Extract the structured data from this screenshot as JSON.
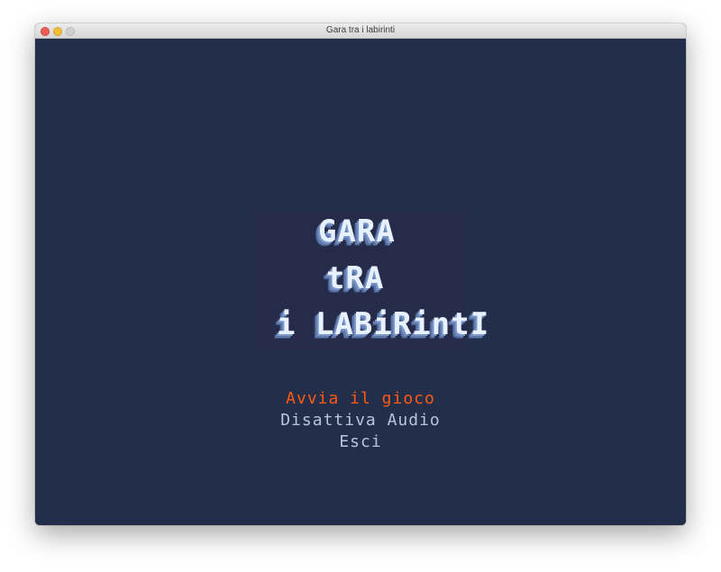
{
  "window": {
    "title": "Gara tra i labirinti"
  },
  "logo": {
    "lines": [
      "GARA",
      "tRA",
      "i LABiRintI"
    ]
  },
  "menu": {
    "items": [
      {
        "label": "Avvia il gioco",
        "selected": true
      },
      {
        "label": "Disattiva Audio",
        "selected": false
      },
      {
        "label": "Esci",
        "selected": false
      }
    ]
  },
  "colors": {
    "background": "#232f4a",
    "selected_item": "#ff5a12",
    "menu_item": "#b9c4d8",
    "logo_text": "#e8f1ff"
  }
}
